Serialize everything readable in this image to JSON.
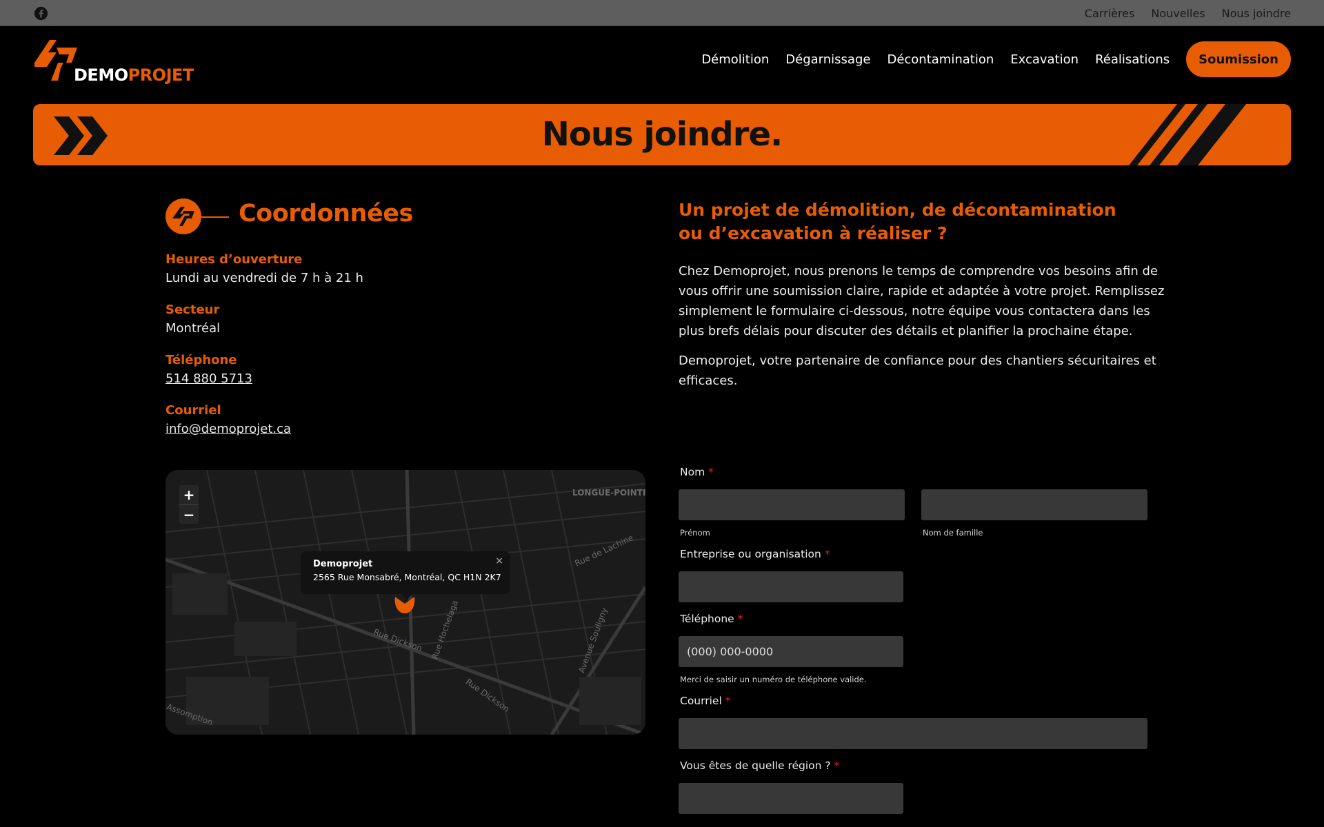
{
  "topbar": {
    "social_icon": "facebook-icon",
    "links": [
      "Carrières",
      "Nouvelles",
      "Nous joindre"
    ]
  },
  "brand": {
    "name_part1": "DEMO",
    "name_part2": "PROJET",
    "accent_color": "#e85d04"
  },
  "nav": {
    "items": [
      "Démolition",
      "Dégarnissage",
      "Décontamination",
      "Excavation",
      "Réalisations"
    ],
    "cta": "Soumission"
  },
  "banner": {
    "title": "Nous joindre."
  },
  "contact": {
    "heading": "Coordonnées",
    "hours_label": "Heures d’ouverture",
    "hours_value": "Lundi au vendredi de 7 h à 21 h",
    "sector_label": "Secteur",
    "sector_value": "Montréal",
    "phone_label": "Téléphone",
    "phone_value": "514 880 5713",
    "email_label": "Courriel",
    "email_value": "info@demoprojet.ca"
  },
  "map": {
    "zoom_in": "+",
    "zoom_out": "−",
    "popup_title": "Demoprojet",
    "popup_address": "2565 Rue Monsabré, Montréal, QC H1N 2K7",
    "popup_close": "×",
    "labels": [
      "LONGUE-POINTE",
      "Rue Dickson",
      "Rue Hochelaga",
      "Avenue Souligny",
      "Rue de Lachine",
      "Rue Dickson",
      "Assomption"
    ]
  },
  "intro": {
    "title": "Un projet de démolition, de décontamination ou d’excavation à réaliser ?",
    "paragraph1": "Chez Demoprojet, nous prenons le temps de comprendre vos besoins afin de vous offrir une soumission claire, rapide et adaptée à votre projet. Remplissez simplement le formulaire ci-dessous, notre équipe vous contactera dans les plus brefs délais pour discuter des détails et planifier la prochaine étape.",
    "paragraph2": "Demoprojet, votre partenaire de confiance pour des chantiers sécuritaires et efficaces."
  },
  "form": {
    "name_label": "Nom",
    "required_mark": "*",
    "first_name_sublabel": "Prénom",
    "last_name_sublabel": "Nom de famille",
    "company_label": "Entreprise ou organisation",
    "phone_label": "Téléphone",
    "phone_placeholder": "(000) 000-0000",
    "phone_hint": "Merci de saisir un numéro de téléphone valide.",
    "email_label": "Courriel",
    "region_label": "Vous êtes de quelle région ?"
  }
}
